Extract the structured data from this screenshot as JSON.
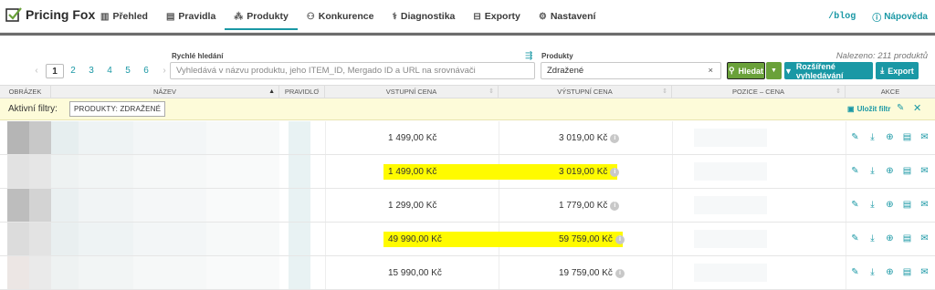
{
  "app": {
    "name": "Pricing Fox"
  },
  "nav": {
    "items": [
      {
        "label": "Přehled",
        "icon": "chart-bars-icon"
      },
      {
        "label": "Pravidla",
        "icon": "rules-icon"
      },
      {
        "label": "Produkty",
        "icon": "products-icon",
        "active": true
      },
      {
        "label": "Konkurence",
        "icon": "users-icon"
      },
      {
        "label": "Diagnostika",
        "icon": "stethoscope-icon"
      },
      {
        "label": "Exporty",
        "icon": "export-icon"
      },
      {
        "label": "Nastavení",
        "icon": "gear-icon"
      }
    ],
    "blog": "/blog",
    "help": "Nápověda"
  },
  "toolbar": {
    "found": "Nalezeno: 211 produktů",
    "pages": [
      "1",
      "2",
      "3",
      "4",
      "5",
      "6"
    ],
    "prev": "‹",
    "next": "›",
    "quick_search_label": "Rychlé hledání",
    "quick_search_placeholder": "Vyhledává v názvu produktu, jeho ITEM_ID, Mergado ID a URL na srovnávači",
    "products_label": "Produkty",
    "products_value": "Zdražené",
    "clear": "×",
    "search_button": "Hledat",
    "advanced_button": "Rozšířené vyhledávání",
    "export_button": "Export"
  },
  "table": {
    "headers": [
      "OBRÁZEK",
      "NÁZEV",
      "PRAVIDLO",
      "VSTUPNÍ CENA",
      "VÝSTUPNÍ CENA",
      "POZICE – CENA",
      "AKCE"
    ]
  },
  "active_filters": {
    "label": "Aktivní filtry:",
    "chip": "PRODUKTY: ZDRAŽENÉ",
    "save": "Uložit filtr"
  },
  "rows": [
    {
      "input_price": "1 499,00 Kč",
      "output_price": "3 019,00 Kč",
      "highlight": false
    },
    {
      "input_price": "1 499,00 Kč",
      "output_price": "3 019,00 Kč",
      "highlight": true
    },
    {
      "input_price": "1 299,00 Kč",
      "output_price": "1 779,00 Kč",
      "highlight": false
    },
    {
      "input_price": "49 990,00 Kč",
      "output_price": "59 759,00 Kč",
      "highlight": true
    },
    {
      "input_price": "15 990,00 Kč",
      "output_price": "19 759,00 Kč",
      "highlight": false
    }
  ],
  "colors": {
    "accent": "#1a98a5",
    "search_green": "#6aa13a",
    "highlight": "#fffb00",
    "filter_bg": "#fdfbd9"
  }
}
